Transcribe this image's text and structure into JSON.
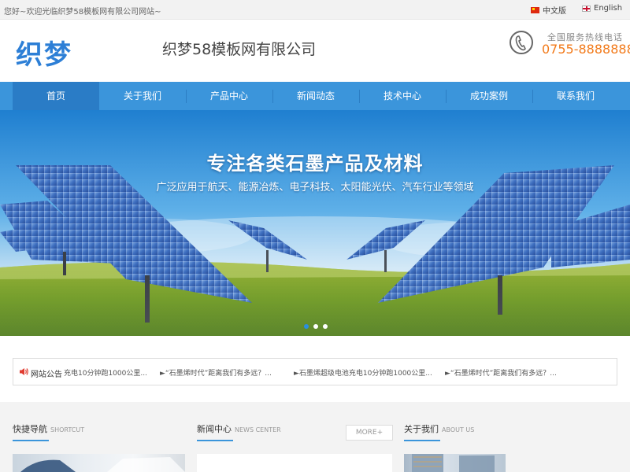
{
  "topbar": {
    "welcome": "您好~欢迎光临织梦58模板网有限公司网站~",
    "lang_cn": "中文版",
    "lang_en": "English"
  },
  "header": {
    "logo": "织梦",
    "company": "织梦58模板网有限公司",
    "hotline_label": "全国服务热线电话",
    "hotline_number": "0755-8888888"
  },
  "nav": {
    "items": [
      "首页",
      "关于我们",
      "产品中心",
      "新闻动态",
      "技术中心",
      "成功案例",
      "联系我们"
    ],
    "active_index": 0
  },
  "banner": {
    "title": "专注各类石墨产品及材料",
    "subtitle": "广泛应用于航天、能源冶炼、电子科技、太阳能光伏、汽车行业等领域",
    "slide_count": 3,
    "active_slide": 0
  },
  "notice": {
    "label": "网站公告",
    "items": [
      "充电10分钟跑1000公里...",
      "►“石墨烯时代”距离我们有多远？...",
      "►石墨烯超级电池充电10分钟跑1000公里...",
      "►“石墨烯时代”距离我们有多远？..."
    ]
  },
  "sections": {
    "shortcut": {
      "title": "快捷导航",
      "subtitle": "SHORTCUT"
    },
    "news": {
      "title": "新闻中心",
      "subtitle": "NEWS CENTER",
      "more": "MORE+"
    },
    "about": {
      "title": "关于我们",
      "subtitle": "ABOUT US"
    }
  },
  "colors": {
    "accent": "#3b95db",
    "nav_active": "#2a7cc6",
    "hotline": "#f27a1a",
    "logo": "#2d7fd6"
  }
}
